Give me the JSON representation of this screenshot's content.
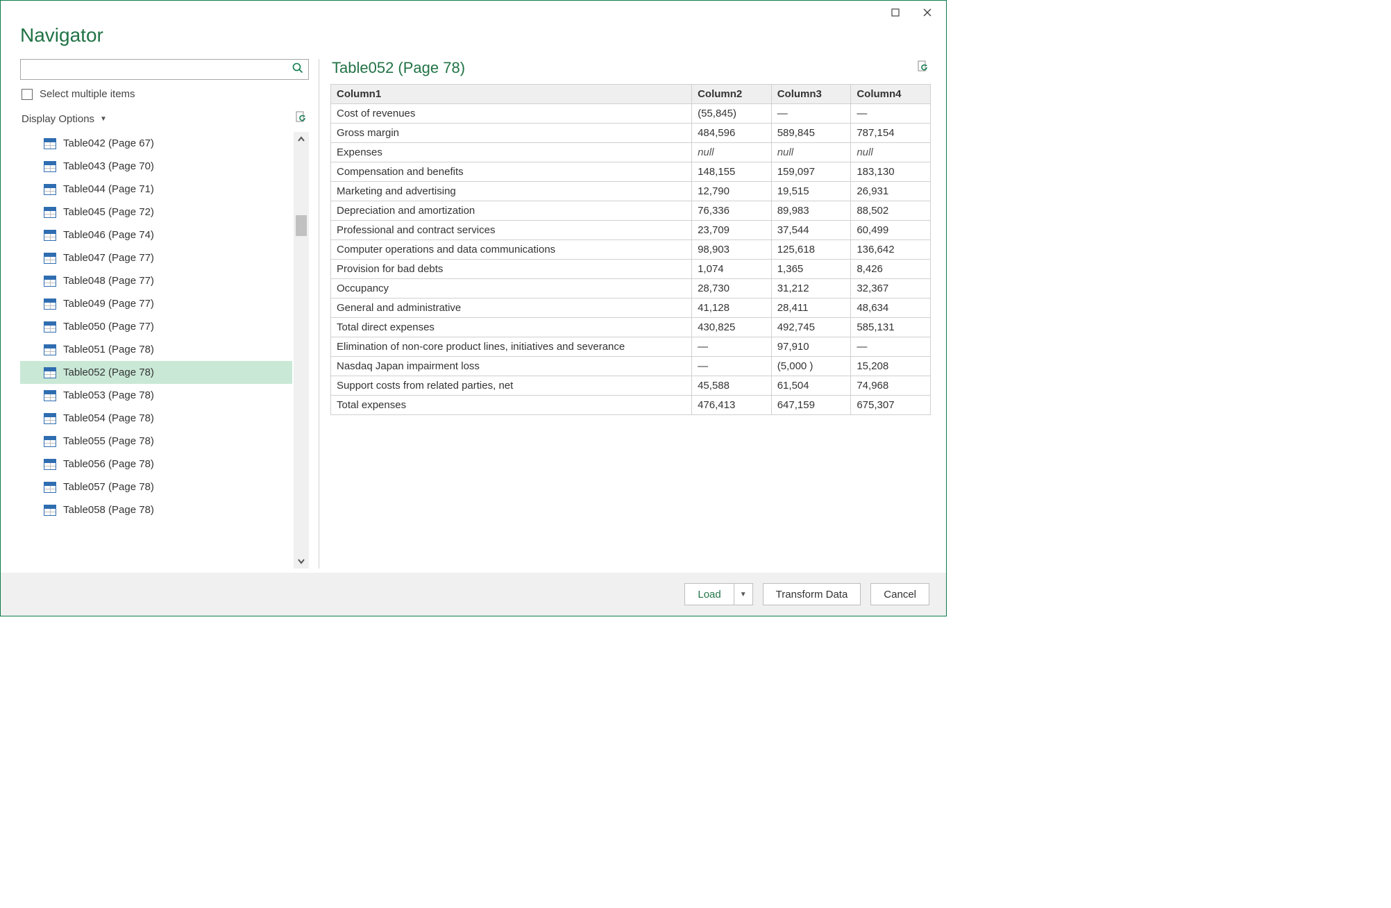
{
  "window": {
    "title": "Navigator"
  },
  "left": {
    "search_placeholder": "",
    "select_multiple_label": "Select multiple items",
    "display_options_label": "Display Options",
    "tree_items": [
      {
        "label": "Table042 (Page 67)",
        "selected": false
      },
      {
        "label": "Table043 (Page 70)",
        "selected": false
      },
      {
        "label": "Table044 (Page 71)",
        "selected": false
      },
      {
        "label": "Table045 (Page 72)",
        "selected": false
      },
      {
        "label": "Table046 (Page 74)",
        "selected": false
      },
      {
        "label": "Table047 (Page 77)",
        "selected": false
      },
      {
        "label": "Table048 (Page 77)",
        "selected": false
      },
      {
        "label": "Table049 (Page 77)",
        "selected": false
      },
      {
        "label": "Table050 (Page 77)",
        "selected": false
      },
      {
        "label": "Table051 (Page 78)",
        "selected": false
      },
      {
        "label": "Table052 (Page 78)",
        "selected": true
      },
      {
        "label": "Table053 (Page 78)",
        "selected": false
      },
      {
        "label": "Table054 (Page 78)",
        "selected": false
      },
      {
        "label": "Table055 (Page 78)",
        "selected": false
      },
      {
        "label": "Table056 (Page 78)",
        "selected": false
      },
      {
        "label": "Table057 (Page 78)",
        "selected": false
      },
      {
        "label": "Table058 (Page 78)",
        "selected": false
      }
    ]
  },
  "preview": {
    "title": "Table052 (Page 78)",
    "columns": [
      "Column1",
      "Column2",
      "Column3",
      "Column4"
    ],
    "rows": [
      [
        "Cost of revenues",
        "(55,845)",
        "—",
        "—"
      ],
      [
        "Gross margin",
        "484,596",
        "589,845",
        "787,154"
      ],
      [
        "Expenses",
        null,
        null,
        null
      ],
      [
        "Compensation and benefits",
        "148,155",
        "159,097",
        "183,130"
      ],
      [
        "Marketing and advertising",
        "12,790",
        "19,515",
        "26,931"
      ],
      [
        "Depreciation and amortization",
        "76,336",
        "89,983",
        "88,502"
      ],
      [
        "Professional and contract services",
        "23,709",
        "37,544",
        "60,499"
      ],
      [
        "Computer operations and data communications",
        "98,903",
        "125,618",
        "136,642"
      ],
      [
        "Provision for bad debts",
        "1,074",
        "1,365",
        "8,426"
      ],
      [
        "Occupancy",
        "28,730",
        "31,212",
        "32,367"
      ],
      [
        "General and administrative",
        "41,128",
        "28,411",
        "48,634"
      ],
      [
        "Total direct expenses",
        "430,825",
        "492,745",
        "585,131"
      ],
      [
        "Elimination of non-core product lines, initiatives and severance",
        "—",
        "97,910",
        "—"
      ],
      [
        "Nasdaq Japan impairment loss",
        "—",
        "(5,000 )",
        "15,208"
      ],
      [
        "Support costs from related parties, net",
        "45,588",
        "61,504",
        "74,968"
      ],
      [
        "Total expenses",
        "476,413",
        "647,159",
        "675,307"
      ]
    ]
  },
  "footer": {
    "load_label": "Load",
    "transform_label": "Transform Data",
    "cancel_label": "Cancel"
  }
}
